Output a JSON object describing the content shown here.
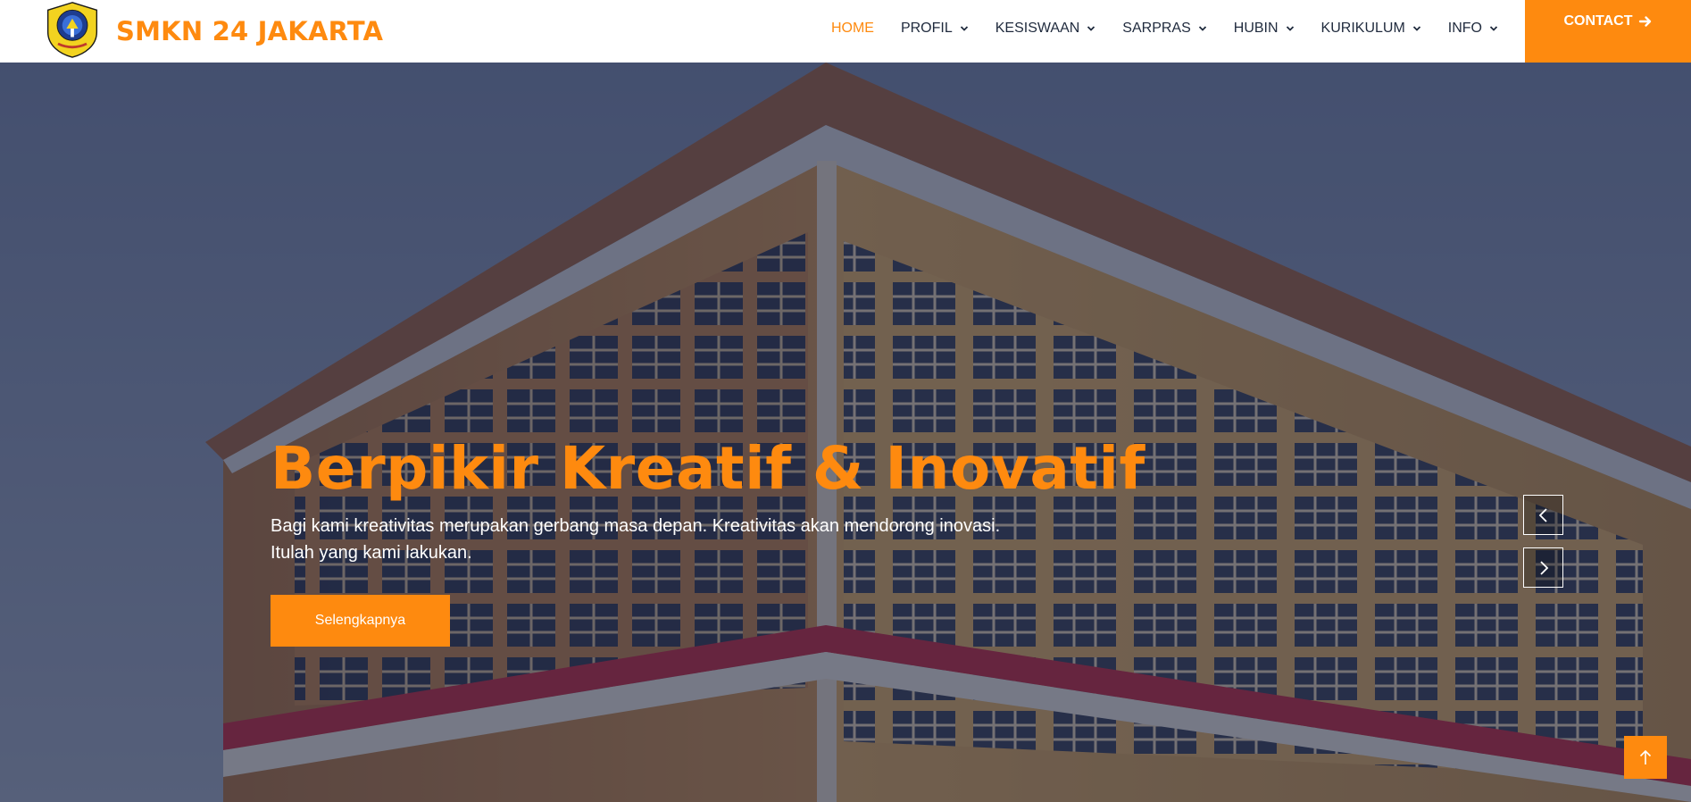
{
  "brand": {
    "name": "SMKN 24 JAKARTA",
    "logo_icon": "school-crest-icon"
  },
  "nav": {
    "items": [
      {
        "label": "HOME",
        "active": true
      },
      {
        "label": "PROFIL",
        "dropdown": true
      },
      {
        "label": "KESISWAAN",
        "dropdown": true
      },
      {
        "label": "SARPRAS",
        "dropdown": true
      },
      {
        "label": "HUBIN",
        "dropdown": true
      },
      {
        "label": "KURIKULUM",
        "dropdown": true
      },
      {
        "label": "INFO",
        "dropdown": true
      }
    ],
    "contact_label": "CONTACT"
  },
  "hero": {
    "title": "Berpikir Kreatif & Inovatif",
    "text": "Bagi kami kreativitas merupakan gerbang masa depan. Kreativitas akan mendorong inovasi. Itulah yang kami lakukan.",
    "button_label": "Selengkapnya"
  },
  "colors": {
    "accent": "#FE8A0F",
    "nav_text": "#1f2a3d",
    "overlay": "#161c37"
  }
}
